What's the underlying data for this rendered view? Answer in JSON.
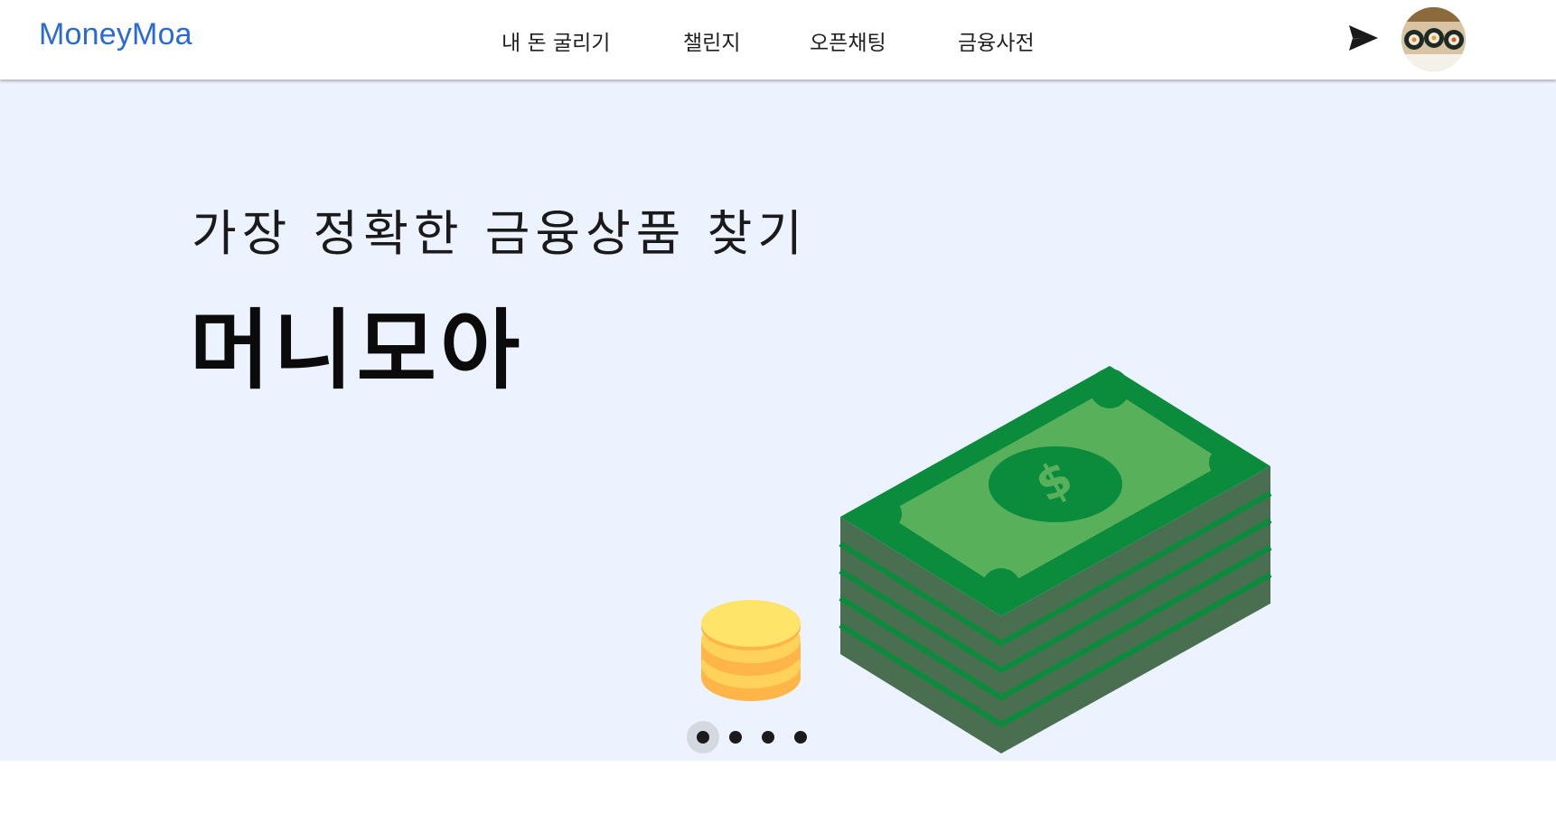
{
  "header": {
    "logo": "MoneyMoa",
    "nav": [
      {
        "label": "내 돈 굴리기"
      },
      {
        "label": "챌린지"
      },
      {
        "label": "오픈채팅"
      },
      {
        "label": "금융사전"
      }
    ],
    "icons": {
      "send": "send-icon",
      "avatar": "avatar"
    }
  },
  "hero": {
    "subtitle": "가장 정확한 금융상품 찾기",
    "title": "머니모아",
    "illustration_symbol": "$",
    "carousel": {
      "slide_count": 4,
      "active_index": 0
    }
  },
  "colors": {
    "brand": "#2a6ad8",
    "hero_bg": "#ecf3fe",
    "money_dark": "#0a8c3c",
    "money_light": "#59b05a",
    "coin": "#ffe46a"
  }
}
